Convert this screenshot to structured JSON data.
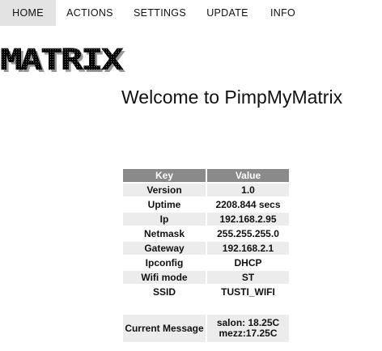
{
  "nav": {
    "items": [
      {
        "label": "HOME",
        "active": true
      },
      {
        "label": "ACTIONS",
        "active": false
      },
      {
        "label": "SETTINGS",
        "active": false
      },
      {
        "label": "UPDATE",
        "active": false
      },
      {
        "label": "INFO",
        "active": false
      }
    ]
  },
  "logo": {
    "text": "MATRIX"
  },
  "page": {
    "title": "Welcome to PimpMyMatrix"
  },
  "table": {
    "headers": {
      "key": "Key",
      "value": "Value"
    },
    "rows": [
      {
        "key": "Version",
        "value": "1.0"
      },
      {
        "key": "Uptime",
        "value": "2208.844 secs"
      },
      {
        "key": "Ip",
        "value": "192.168.2.95"
      },
      {
        "key": "Netmask",
        "value": "255.255.255.0"
      },
      {
        "key": "Gateway",
        "value": "192.168.2.1"
      },
      {
        "key": "Ipconfig",
        "value": "DHCP"
      },
      {
        "key": "Wifi mode",
        "value": "ST"
      },
      {
        "key": "SSID",
        "value": "TUSTI_WIFI"
      }
    ],
    "message": {
      "key": "Current Message",
      "line1": "salon: 18.25C",
      "line2": "mezz:17.25C"
    }
  },
  "colors": {
    "header_bg": "#8a8a8a",
    "row_alt_bg": "#ececec",
    "nav_active_bg": "#e3e3e3"
  }
}
